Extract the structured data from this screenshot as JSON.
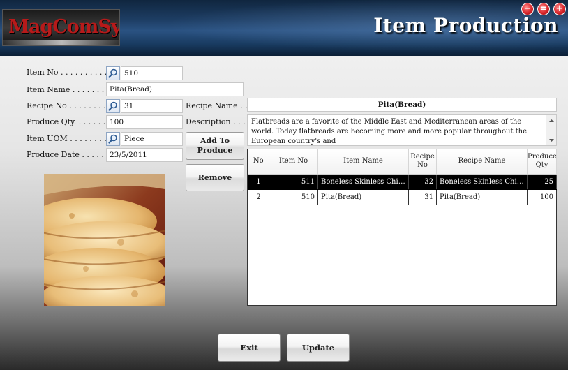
{
  "header": {
    "logo_text": "MagComSys",
    "title": "Item Production",
    "window_controls": {
      "minimize": "−",
      "restore": "=",
      "maximize": "+"
    }
  },
  "form": {
    "item_no_label": "Item No . . . . . . . . . .",
    "item_no_value": "510",
    "item_name_label": "Item Name . . . . . . . .",
    "item_name_value": "Pita(Bread)",
    "recipe_no_label": "Recipe No . . . . . . . .",
    "recipe_no_value": "31",
    "produce_qty_label": "Produce Qty. . . . . . .",
    "produce_qty_value": "100",
    "item_uom_label": "Item UOM . . . . . . . .",
    "item_uom_value": "Piece",
    "produce_date_label": "Produce Date . . . . . .",
    "produce_date_value": "23/5/2011",
    "recipe_name_label": "Recipe Name . .",
    "recipe_name_value": "Pita(Bread)",
    "description_label": "Description . . .",
    "description_value": "Flatbreads are a favorite of the Middle East and Mediterranean areas of the world. Today flatbreads are becoming more and more popular throughout the European country's and"
  },
  "buttons": {
    "add_to_produce": "Add To Produce",
    "remove": "Remove",
    "exit": "Exit",
    "update": "Update"
  },
  "grid": {
    "columns": [
      "No",
      "Item No",
      "Item Name",
      "Recipe No",
      "Recipe Name",
      "Produce Qty"
    ],
    "rows": [
      {
        "no": "1",
        "item_no": "511",
        "item_name": "Boneless Skinless Chick...",
        "recipe_no": "32",
        "recipe_name": "Boneless Skinless Chick...",
        "produce_qty": "25",
        "selected": true
      },
      {
        "no": "2",
        "item_no": "510",
        "item_name": "Pita(Bread)",
        "recipe_no": "31",
        "recipe_name": "Pita(Bread)",
        "produce_qty": "100",
        "selected": false
      }
    ]
  },
  "colors": {
    "header_bg": "#1d3d63",
    "logo_red": "#b71a1a",
    "window_button_red": "#d9262b",
    "selected_row_bg": "#000000"
  }
}
